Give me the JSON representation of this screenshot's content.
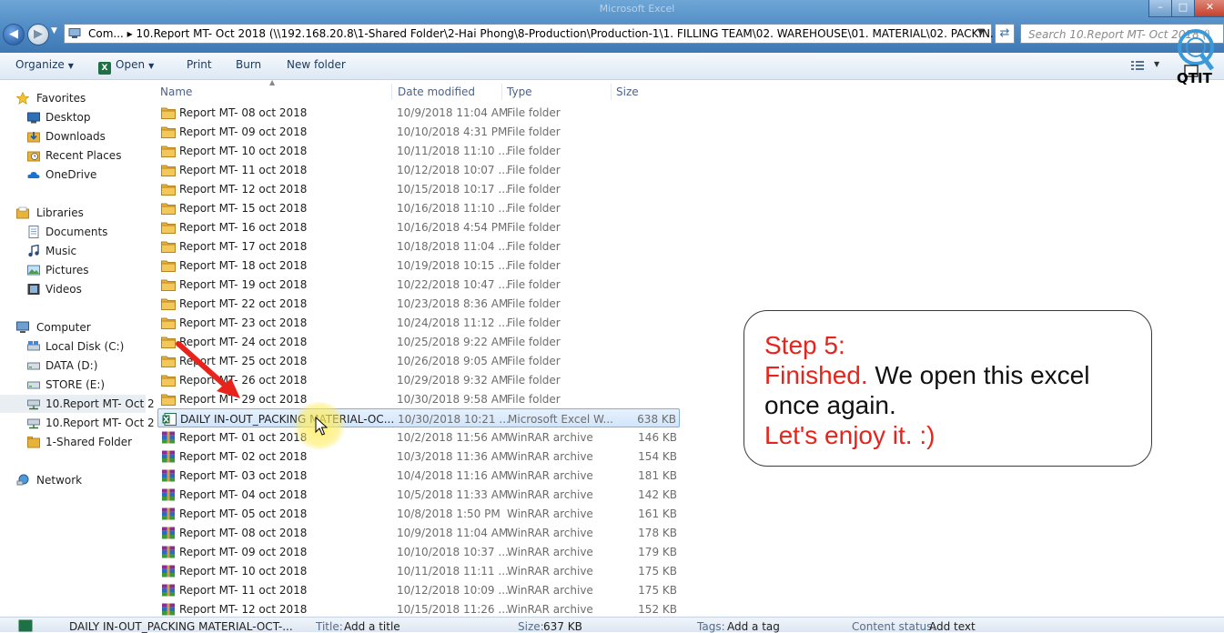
{
  "window": {
    "title": "Microsoft Excel"
  },
  "address": {
    "path": "Com... ▸ 10.Report MT- Oct 2018 (\\\\192.168.20.8\\1-Shared Folder\\2-Hai Phong\\8-Production\\Production-1\\1. FILLING TEAM\\02. WAREHOUSE\\01. MATERIAL\\02. PACKIN... ▸",
    "search_placeholder": "Search 10.Report MT- Oct 2018 (\\\\192..."
  },
  "toolbar": {
    "organize": "Organize",
    "open": "Open",
    "print": "Print",
    "burn": "Burn",
    "new_folder": "New folder"
  },
  "logo": {
    "text": "QTIT"
  },
  "sidebar": {
    "favorites": "Favorites",
    "desktop": "Desktop",
    "downloads": "Downloads",
    "recent_places": "Recent Places",
    "onedrive": "OneDrive",
    "libraries": "Libraries",
    "documents": "Documents",
    "music": "Music",
    "pictures": "Pictures",
    "videos": "Videos",
    "computer": "Computer",
    "local_disk": "Local Disk (C:)",
    "data_d": "DATA (D:)",
    "store_e": "STORE (E:)",
    "report_1": "10.Report MT- Oct 2",
    "report_2": "10.Report MT- Oct 2",
    "shared_folder": "1-Shared Folder",
    "network": "Network"
  },
  "columns": {
    "name": "Name",
    "date": "Date modified",
    "type": "Type",
    "size": "Size"
  },
  "files": [
    {
      "name": "Report MT- 08 oct 2018",
      "date": "10/9/2018 11:04 AM",
      "type": "File folder",
      "size": "",
      "kind": "folder"
    },
    {
      "name": "Report MT- 09 oct 2018",
      "date": "10/10/2018 4:31 PM",
      "type": "File folder",
      "size": "",
      "kind": "folder"
    },
    {
      "name": "Report MT- 10 oct 2018",
      "date": "10/11/2018 11:10 ...",
      "type": "File folder",
      "size": "",
      "kind": "folder"
    },
    {
      "name": "Report MT- 11 oct 2018",
      "date": "10/12/2018 10:07 ...",
      "type": "File folder",
      "size": "",
      "kind": "folder"
    },
    {
      "name": "Report MT- 12 oct 2018",
      "date": "10/15/2018 10:17 ...",
      "type": "File folder",
      "size": "",
      "kind": "folder"
    },
    {
      "name": "Report MT- 15 oct 2018",
      "date": "10/16/2018 11:10 ...",
      "type": "File folder",
      "size": "",
      "kind": "folder"
    },
    {
      "name": "Report MT- 16 oct 2018",
      "date": "10/16/2018 4:54 PM",
      "type": "File folder",
      "size": "",
      "kind": "folder"
    },
    {
      "name": "Report MT- 17 oct 2018",
      "date": "10/18/2018 11:04 ...",
      "type": "File folder",
      "size": "",
      "kind": "folder"
    },
    {
      "name": "Report MT- 18 oct 2018",
      "date": "10/19/2018 10:15 ...",
      "type": "File folder",
      "size": "",
      "kind": "folder"
    },
    {
      "name": "Report MT- 19 oct 2018",
      "date": "10/22/2018 10:47 ...",
      "type": "File folder",
      "size": "",
      "kind": "folder"
    },
    {
      "name": "Report MT- 22 oct 2018",
      "date": "10/23/2018 8:36 AM",
      "type": "File folder",
      "size": "",
      "kind": "folder"
    },
    {
      "name": "Report MT- 23 oct 2018",
      "date": "10/24/2018 11:12 ...",
      "type": "File folder",
      "size": "",
      "kind": "folder"
    },
    {
      "name": "Report MT- 24 oct 2018",
      "date": "10/25/2018 9:22 AM",
      "type": "File folder",
      "size": "",
      "kind": "folder"
    },
    {
      "name": "Report MT- 25 oct 2018",
      "date": "10/26/2018 9:05 AM",
      "type": "File folder",
      "size": "",
      "kind": "folder"
    },
    {
      "name": "Report MT- 26 oct 2018",
      "date": "10/29/2018 9:32 AM",
      "type": "File folder",
      "size": "",
      "kind": "folder"
    },
    {
      "name": "Report MT- 29 oct 2018",
      "date": "10/30/2018 9:58 AM",
      "type": "File folder",
      "size": "",
      "kind": "folder"
    },
    {
      "name": "DAILY IN-OUT_PACKING MATERIAL-OC...",
      "date": "10/30/2018 10:21 ...",
      "type": "Microsoft Excel W...",
      "size": "638 KB",
      "kind": "excel",
      "selected": true
    },
    {
      "name": "Report MT- 01 oct 2018",
      "date": "10/2/2018 11:56 AM",
      "type": "WinRAR archive",
      "size": "146 KB",
      "kind": "rar"
    },
    {
      "name": "Report MT- 02 oct 2018",
      "date": "10/3/2018 11:36 AM",
      "type": "WinRAR archive",
      "size": "154 KB",
      "kind": "rar"
    },
    {
      "name": "Report MT- 03 oct 2018",
      "date": "10/4/2018 11:16 AM",
      "type": "WinRAR archive",
      "size": "181 KB",
      "kind": "rar"
    },
    {
      "name": "Report MT- 04 oct 2018",
      "date": "10/5/2018 11:33 AM",
      "type": "WinRAR archive",
      "size": "142 KB",
      "kind": "rar"
    },
    {
      "name": "Report MT- 05 oct 2018",
      "date": "10/8/2018 1:50 PM",
      "type": "WinRAR archive",
      "size": "161 KB",
      "kind": "rar"
    },
    {
      "name": "Report MT- 08 oct 2018",
      "date": "10/9/2018 11:04 AM",
      "type": "WinRAR archive",
      "size": "178 KB",
      "kind": "rar"
    },
    {
      "name": "Report MT- 09 oct 2018",
      "date": "10/10/2018 10:37 ...",
      "type": "WinRAR archive",
      "size": "179 KB",
      "kind": "rar"
    },
    {
      "name": "Report MT- 10 oct 2018",
      "date": "10/11/2018 11:11 ...",
      "type": "WinRAR archive",
      "size": "175 KB",
      "kind": "rar"
    },
    {
      "name": "Report MT- 11 oct 2018",
      "date": "10/12/2018 10:09 ...",
      "type": "WinRAR archive",
      "size": "175 KB",
      "kind": "rar"
    },
    {
      "name": "Report MT- 12 oct 2018",
      "date": "10/15/2018 11:26 ...",
      "type": "WinRAR archive",
      "size": "152 KB",
      "kind": "rar"
    }
  ],
  "details": {
    "filename": "DAILY IN-OUT_PACKING MATERIAL-OCT-...",
    "title_label": "Title:",
    "title_value": "Add a title",
    "size_label": "Size:",
    "size_value": "637 KB",
    "tags_label": "Tags:",
    "tags_value": "Add a tag",
    "status_label": "Content status:",
    "status_value": "Add text"
  },
  "callout": {
    "step": "Step 5:",
    "finished": "Finished.",
    "line1": " We open this excel",
    "line2": "once again.",
    "line3": "Let's enjoy it. :)"
  },
  "colors": {
    "accent_red": "#e8231b",
    "folder": "#e8b33a",
    "excel_green": "#1e7145",
    "selection_border": "#84acdd"
  }
}
